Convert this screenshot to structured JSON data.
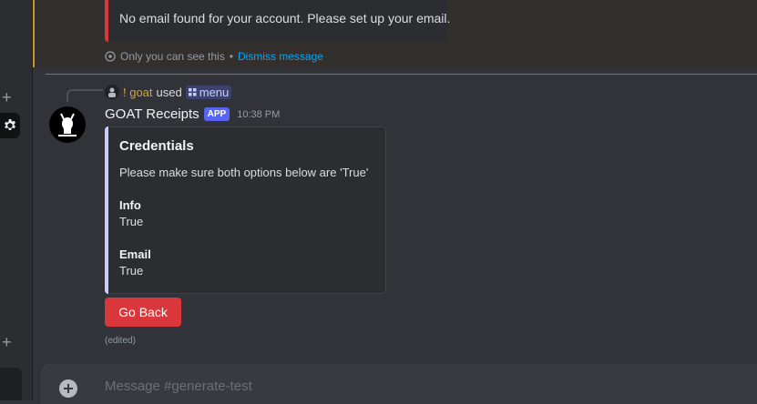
{
  "ephemeral": {
    "embed_text": "No email found for your account. Please set up your email.",
    "visibility_note": "Only you can see this",
    "separator": "•",
    "dismiss_label": "Dismiss message"
  },
  "command": {
    "user": "! goat",
    "used_text": "used",
    "command_name": "menu"
  },
  "message": {
    "bot_name": "GOAT Receipts",
    "badge": "APP",
    "timestamp": "10:38 PM",
    "edited": "(edited)",
    "embed": {
      "title": "Credentials",
      "description": "Please make sure both options below are 'True'",
      "fields": [
        {
          "name": "Info",
          "value": "True"
        },
        {
          "name": "Email",
          "value": "True"
        }
      ]
    },
    "button_label": "Go Back"
  },
  "composer": {
    "placeholder": "Message #generate-test"
  },
  "colors": {
    "background": "#313338",
    "button_danger": "#da373c",
    "app_badge": "#5865f2",
    "link": "#00a8fc",
    "username": "#d6a333"
  },
  "icons": [
    "plus-icon",
    "gear-icon",
    "eye-icon",
    "slash-command-icon",
    "add-attachment-icon"
  ]
}
